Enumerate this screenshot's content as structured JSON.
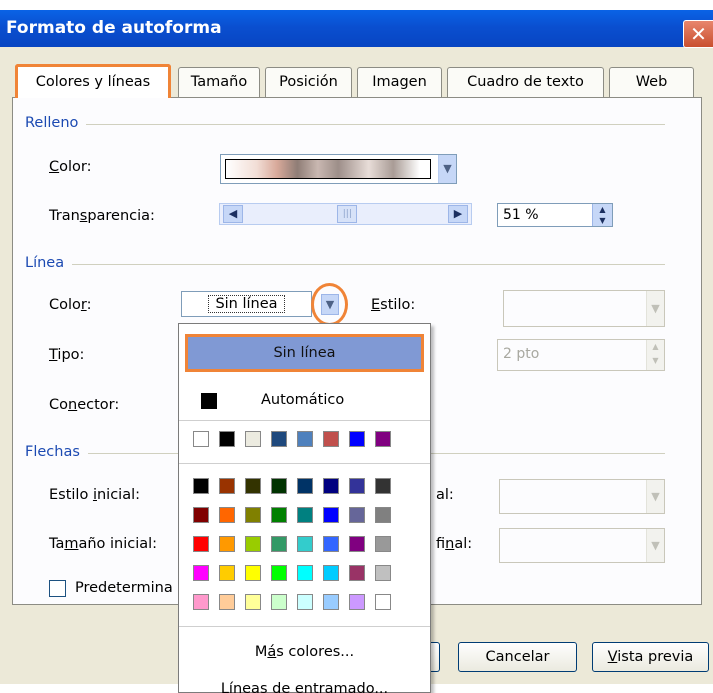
{
  "window": {
    "title": "Formato de autoforma",
    "close": "✕"
  },
  "tabs": [
    "Colores y líneas",
    "Tamaño",
    "Posición",
    "Imagen",
    "Cuadro de texto",
    "Web"
  ],
  "relleno": {
    "group": "Relleno",
    "color_label_u": "C",
    "color_label_rest": "olor:",
    "transparencia_pre": "Tran",
    "transparencia_u": "s",
    "transparencia_post": "parencia:",
    "transparencia_value": "51 %",
    "transparencia_level": 0.51
  },
  "linea": {
    "group": "Línea",
    "color_pre": "Colo",
    "color_u": "r",
    "color_post": ":",
    "color_value": "Sin línea",
    "estilo_u": "E",
    "estilo_rest": "stilo:",
    "tipo_u": "T",
    "tipo_rest": "ipo:",
    "grosor_value": "2 pto",
    "conector_pre": "Co",
    "conector_u": "n",
    "conector_post": "ector:"
  },
  "flechas": {
    "group": "Flechas",
    "estilo_inicial_pre": "Estilo ",
    "estilo_inicial_u": "i",
    "estilo_inicial_post": "nicial:",
    "estilo_final_partial": "al:",
    "tamano_inicial_pre": "Ta",
    "tamano_inicial_u": "m",
    "tamano_inicial_post": "año inicial:",
    "tamano_final_pre": "fi",
    "tamano_final_u": "n",
    "tamano_final_post": "al:",
    "predeterminar_partial": "Predetermina"
  },
  "popup": {
    "sin_linea": "Sin línea",
    "automatico": "Automático",
    "row1": [
      "#ffffff",
      "#000000",
      "#ecebe0",
      "#1f497d",
      "#4f81bd",
      "#c0504d",
      "#0000ff",
      "#800080"
    ],
    "grid": [
      [
        "#000000",
        "#993300",
        "#333300",
        "#003300",
        "#003366",
        "#000080",
        "#333399",
        "#333333"
      ],
      [
        "#800000",
        "#ff6600",
        "#808000",
        "#008000",
        "#008080",
        "#0000ff",
        "#666699",
        "#808080"
      ],
      [
        "#ff0000",
        "#ff9900",
        "#99cc00",
        "#339966",
        "#33cccc",
        "#3366ff",
        "#800080",
        "#999999"
      ],
      [
        "#ff00ff",
        "#ffcc00",
        "#ffff00",
        "#00ff00",
        "#00ffff",
        "#00ccff",
        "#993366",
        "#c0c0c0"
      ],
      [
        "#ff99cc",
        "#ffcc99",
        "#ffff99",
        "#ccffcc",
        "#ccffff",
        "#99ccff",
        "#cc99ff",
        "#ffffff"
      ]
    ],
    "mas_colores_pre": "M",
    "mas_colores_u": "á",
    "mas_colores_post": "s colores...",
    "lineas_entramado": "Líneas de entramado..."
  },
  "buttons": {
    "cancelar": "Cancelar",
    "vista_previa_u": "V",
    "vista_previa_rest": "ista previa"
  },
  "colors": {
    "highlight": "#f08437",
    "title_bar": "#0a4fd0",
    "group_label": "#1c4ab2"
  }
}
